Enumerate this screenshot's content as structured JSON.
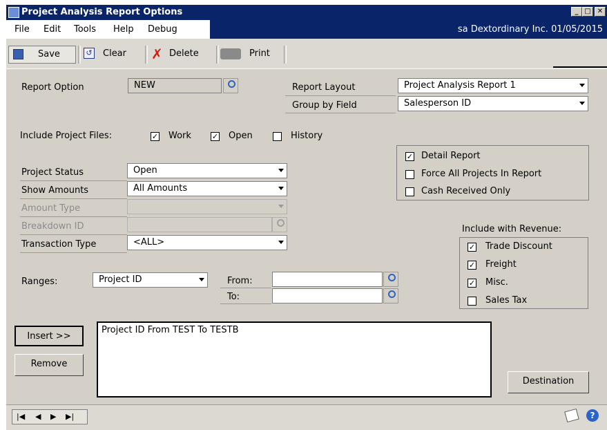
{
  "window": {
    "title": "Project Analysis  Report Options"
  },
  "menu": {
    "items": [
      "File",
      "Edit",
      "Tools",
      "Help",
      "Debug"
    ],
    "status": "sa  Dextordinary Inc.  01/05/2015"
  },
  "toolbar": {
    "save": "Save",
    "clear": "Clear",
    "delete": "Delete",
    "print": "Print"
  },
  "form": {
    "report_option_label": "Report Option",
    "report_option_value": "NEW",
    "report_layout_label": "Report Layout",
    "report_layout_value": "Project Analysis Report 1",
    "group_by_label": "Group by Field",
    "group_by_value": "Salesperson ID",
    "include_files_label": "Include Project Files:",
    "include_files": [
      {
        "label": "Work",
        "checked": true
      },
      {
        "label": "Open",
        "checked": true
      },
      {
        "label": "History",
        "checked": false
      }
    ],
    "report_flags": [
      {
        "label": "Detail Report",
        "checked": true
      },
      {
        "label": "Force All Projects In Report",
        "checked": false
      },
      {
        "label": "Cash Received Only",
        "checked": false
      }
    ],
    "project_status_label": "Project Status",
    "project_status_value": "Open",
    "show_amounts_label": "Show Amounts",
    "show_amounts_value": "All Amounts",
    "amount_type_label": "Amount Type",
    "breakdown_id_label": "Breakdown ID",
    "transaction_type_label": "Transaction Type",
    "transaction_type_value": "<ALL>",
    "include_revenue_label": "Include with Revenue:",
    "include_revenue": [
      {
        "label": "Trade Discount",
        "checked": true
      },
      {
        "label": "Freight",
        "checked": true
      },
      {
        "label": "Misc.",
        "checked": true
      },
      {
        "label": "Sales Tax",
        "checked": false
      }
    ],
    "ranges_label": "Ranges:",
    "ranges_value": "Project ID",
    "from_label": "From:",
    "to_label": "To:",
    "from_value": "",
    "to_value": "",
    "insert_button": "Insert >>",
    "remove_button": "Remove",
    "restrictions": [
      "Project ID From TEST To  TESTB"
    ],
    "destination_button": "Destination"
  }
}
